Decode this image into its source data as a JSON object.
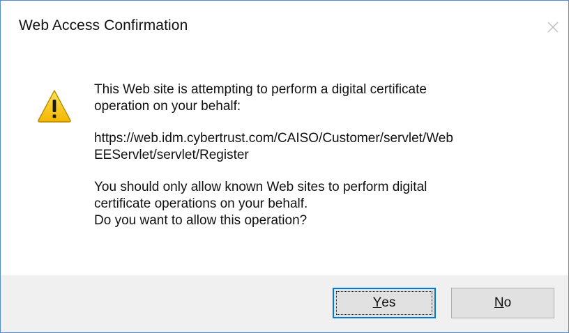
{
  "window": {
    "title": "Web Access Confirmation",
    "close_icon": "close-icon"
  },
  "message": {
    "icon": "warning-icon",
    "line1": "This Web site is attempting to perform a digital certificate",
    "line2": "operation on your behalf:",
    "url_line1": "https://web.idm.cybertrust.com/CAISO/Customer/servlet/Web",
    "url_line2": "EEServlet/servlet/Register",
    "line3": "You should only allow known Web sites to perform digital",
    "line4": "certificate operations on your behalf.",
    "line5": "Do you want to allow this operation?"
  },
  "buttons": {
    "yes_mnemonic": "Y",
    "yes_rest": "es",
    "no_mnemonic": "N",
    "no_rest": "o"
  },
  "colors": {
    "border": "#4f8bd6",
    "footer_bg": "#f0f0f0",
    "button_bg": "#e1e1e1",
    "focus": "#0078d7",
    "warning_fill": "#f7c600"
  }
}
